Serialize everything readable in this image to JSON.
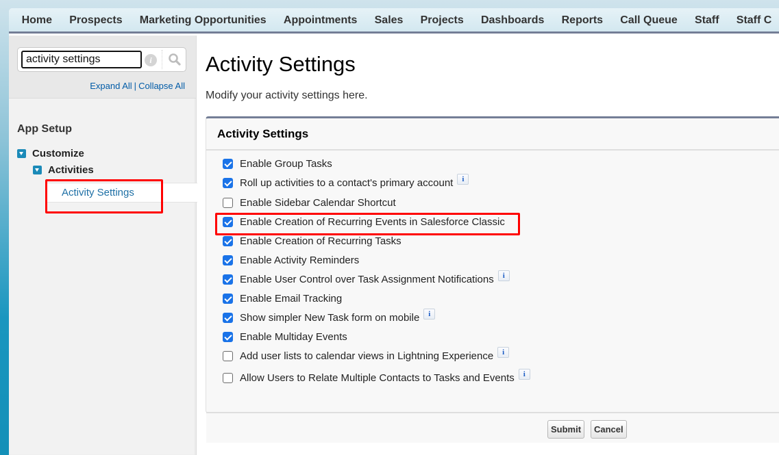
{
  "nav": {
    "tabs": [
      "Home",
      "Prospects",
      "Marketing Opportunities",
      "Appointments",
      "Sales",
      "Projects",
      "Dashboards",
      "Reports",
      "Call Queue",
      "Staff",
      "Staff C"
    ]
  },
  "sidebar": {
    "search": {
      "value": "activity settings",
      "info_icon": "info-icon",
      "search_icon": "search-icon"
    },
    "expand_all": "Expand All",
    "separator": "|",
    "collapse_all": "Collapse All",
    "section_title": "App Setup",
    "tree": {
      "customize": "Customize",
      "activities": "Activities",
      "activity_settings": "Activity Settings"
    }
  },
  "main": {
    "title": "Activity Settings",
    "description": "Modify your activity settings here.",
    "panel": {
      "title": "Activity Settings",
      "options": [
        {
          "label": "Enable Group Tasks",
          "checked": true,
          "info": false
        },
        {
          "label": "Roll up activities to a contact's primary account",
          "checked": true,
          "info": true
        },
        {
          "label": "Enable Sidebar Calendar Shortcut",
          "checked": false,
          "info": false
        },
        {
          "label": "Enable Creation of Recurring Events in Salesforce Classic",
          "checked": true,
          "info": false
        },
        {
          "label": "Enable Creation of Recurring Tasks",
          "checked": true,
          "info": false
        },
        {
          "label": "Enable Activity Reminders",
          "checked": true,
          "info": false
        },
        {
          "label": "Enable User Control over Task Assignment Notifications",
          "checked": true,
          "info": true
        },
        {
          "label": "Enable Email Tracking",
          "checked": true,
          "info": false
        },
        {
          "label": "Show simpler New Task form on mobile",
          "checked": true,
          "info": true
        },
        {
          "label": "Enable Multiday Events",
          "checked": true,
          "info": false
        },
        {
          "label": "Add user lists to calendar views in Lightning Experience",
          "checked": false,
          "info": true
        },
        {
          "label": "Allow Users to Relate Multiple Contacts to Tasks and Events",
          "checked": false,
          "info": true
        }
      ],
      "info_glyph": "i",
      "submit_label": "Submit",
      "cancel_label": "Cancel"
    }
  },
  "colors": {
    "highlight": "#ff0000",
    "link": "#015ba7",
    "checkbox": "#1a73e8",
    "tree_toggle": "#1b8ab8",
    "header_border": "#747e96"
  }
}
